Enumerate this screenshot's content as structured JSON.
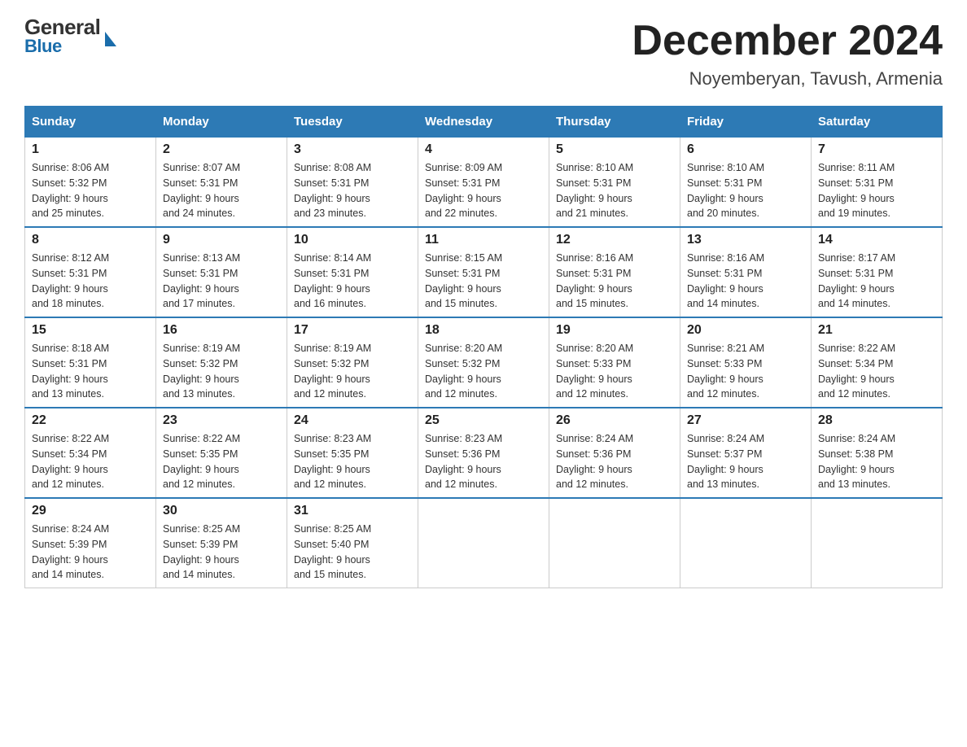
{
  "header": {
    "logo_general": "General",
    "logo_blue": "Blue",
    "month_title": "December 2024",
    "location": "Noyemberyan, Tavush, Armenia"
  },
  "days_of_week": [
    "Sunday",
    "Monday",
    "Tuesday",
    "Wednesday",
    "Thursday",
    "Friday",
    "Saturday"
  ],
  "weeks": [
    [
      {
        "day": "1",
        "sunrise": "8:06 AM",
        "sunset": "5:32 PM",
        "daylight": "9 hours and 25 minutes."
      },
      {
        "day": "2",
        "sunrise": "8:07 AM",
        "sunset": "5:31 PM",
        "daylight": "9 hours and 24 minutes."
      },
      {
        "day": "3",
        "sunrise": "8:08 AM",
        "sunset": "5:31 PM",
        "daylight": "9 hours and 23 minutes."
      },
      {
        "day": "4",
        "sunrise": "8:09 AM",
        "sunset": "5:31 PM",
        "daylight": "9 hours and 22 minutes."
      },
      {
        "day": "5",
        "sunrise": "8:10 AM",
        "sunset": "5:31 PM",
        "daylight": "9 hours and 21 minutes."
      },
      {
        "day": "6",
        "sunrise": "8:10 AM",
        "sunset": "5:31 PM",
        "daylight": "9 hours and 20 minutes."
      },
      {
        "day": "7",
        "sunrise": "8:11 AM",
        "sunset": "5:31 PM",
        "daylight": "9 hours and 19 minutes."
      }
    ],
    [
      {
        "day": "8",
        "sunrise": "8:12 AM",
        "sunset": "5:31 PM",
        "daylight": "9 hours and 18 minutes."
      },
      {
        "day": "9",
        "sunrise": "8:13 AM",
        "sunset": "5:31 PM",
        "daylight": "9 hours and 17 minutes."
      },
      {
        "day": "10",
        "sunrise": "8:14 AM",
        "sunset": "5:31 PM",
        "daylight": "9 hours and 16 minutes."
      },
      {
        "day": "11",
        "sunrise": "8:15 AM",
        "sunset": "5:31 PM",
        "daylight": "9 hours and 15 minutes."
      },
      {
        "day": "12",
        "sunrise": "8:16 AM",
        "sunset": "5:31 PM",
        "daylight": "9 hours and 15 minutes."
      },
      {
        "day": "13",
        "sunrise": "8:16 AM",
        "sunset": "5:31 PM",
        "daylight": "9 hours and 14 minutes."
      },
      {
        "day": "14",
        "sunrise": "8:17 AM",
        "sunset": "5:31 PM",
        "daylight": "9 hours and 14 minutes."
      }
    ],
    [
      {
        "day": "15",
        "sunrise": "8:18 AM",
        "sunset": "5:31 PM",
        "daylight": "9 hours and 13 minutes."
      },
      {
        "day": "16",
        "sunrise": "8:19 AM",
        "sunset": "5:32 PM",
        "daylight": "9 hours and 13 minutes."
      },
      {
        "day": "17",
        "sunrise": "8:19 AM",
        "sunset": "5:32 PM",
        "daylight": "9 hours and 12 minutes."
      },
      {
        "day": "18",
        "sunrise": "8:20 AM",
        "sunset": "5:32 PM",
        "daylight": "9 hours and 12 minutes."
      },
      {
        "day": "19",
        "sunrise": "8:20 AM",
        "sunset": "5:33 PM",
        "daylight": "9 hours and 12 minutes."
      },
      {
        "day": "20",
        "sunrise": "8:21 AM",
        "sunset": "5:33 PM",
        "daylight": "9 hours and 12 minutes."
      },
      {
        "day": "21",
        "sunrise": "8:22 AM",
        "sunset": "5:34 PM",
        "daylight": "9 hours and 12 minutes."
      }
    ],
    [
      {
        "day": "22",
        "sunrise": "8:22 AM",
        "sunset": "5:34 PM",
        "daylight": "9 hours and 12 minutes."
      },
      {
        "day": "23",
        "sunrise": "8:22 AM",
        "sunset": "5:35 PM",
        "daylight": "9 hours and 12 minutes."
      },
      {
        "day": "24",
        "sunrise": "8:23 AM",
        "sunset": "5:35 PM",
        "daylight": "9 hours and 12 minutes."
      },
      {
        "day": "25",
        "sunrise": "8:23 AM",
        "sunset": "5:36 PM",
        "daylight": "9 hours and 12 minutes."
      },
      {
        "day": "26",
        "sunrise": "8:24 AM",
        "sunset": "5:36 PM",
        "daylight": "9 hours and 12 minutes."
      },
      {
        "day": "27",
        "sunrise": "8:24 AM",
        "sunset": "5:37 PM",
        "daylight": "9 hours and 13 minutes."
      },
      {
        "day": "28",
        "sunrise": "8:24 AM",
        "sunset": "5:38 PM",
        "daylight": "9 hours and 13 minutes."
      }
    ],
    [
      {
        "day": "29",
        "sunrise": "8:24 AM",
        "sunset": "5:39 PM",
        "daylight": "9 hours and 14 minutes."
      },
      {
        "day": "30",
        "sunrise": "8:25 AM",
        "sunset": "5:39 PM",
        "daylight": "9 hours and 14 minutes."
      },
      {
        "day": "31",
        "sunrise": "8:25 AM",
        "sunset": "5:40 PM",
        "daylight": "9 hours and 15 minutes."
      },
      null,
      null,
      null,
      null
    ]
  ],
  "labels": {
    "sunrise": "Sunrise:",
    "sunset": "Sunset:",
    "daylight": "Daylight:"
  }
}
